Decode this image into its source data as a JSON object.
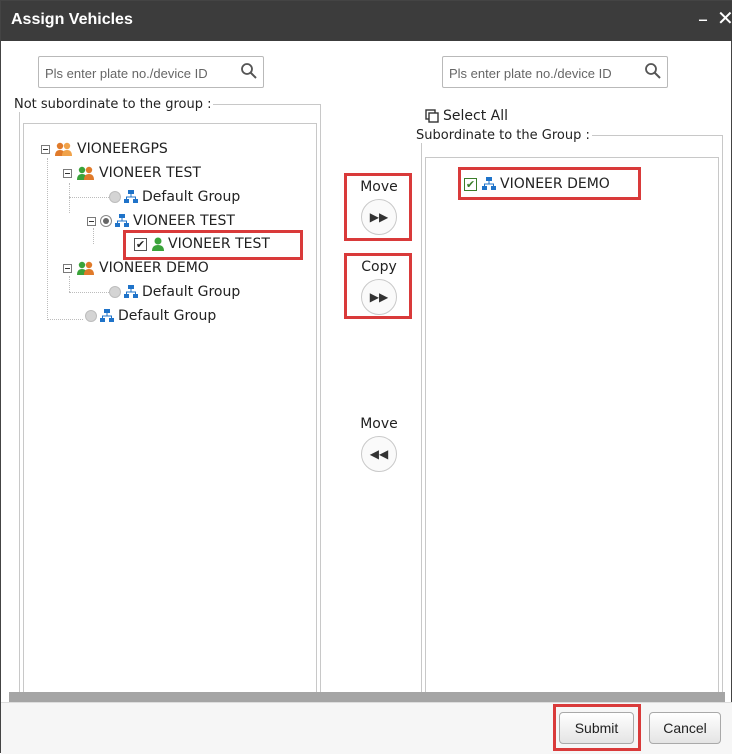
{
  "window": {
    "title": "Assign Vehicles",
    "minimize": "–",
    "close": "✕"
  },
  "left": {
    "search_placeholder": "Pls enter plate no./device ID",
    "group_label": "Not subordinate to the group :",
    "tree": [
      {
        "label": "VIONEERGPS",
        "icon": "users-group-icon"
      },
      {
        "label": "VIONEER TEST",
        "icon": "users-group-icon"
      },
      {
        "label": "Default Group",
        "icon": "org-chart-icon"
      },
      {
        "label": "VIONEER TEST",
        "icon": "org-chart-icon"
      },
      {
        "label": "VIONEER TEST",
        "icon": "user-green-icon",
        "checked": true
      },
      {
        "label": "VIONEER DEMO",
        "icon": "users-group-icon"
      },
      {
        "label": "Default Group",
        "icon": "org-chart-icon"
      },
      {
        "label": "Default Group",
        "icon": "org-chart-icon"
      }
    ]
  },
  "middle": {
    "move_right_label": "Move",
    "copy_label": "Copy",
    "move_left_label": "Move"
  },
  "right": {
    "search_placeholder": "Pls enter plate no./device ID",
    "select_all": "Select All",
    "group_label": "Subordinate to the Group :",
    "items": [
      {
        "label": "VIONEER DEMO",
        "icon": "org-chart-icon",
        "checked": true
      }
    ]
  },
  "footer": {
    "submit": "Submit",
    "cancel": "Cancel"
  },
  "colors": {
    "titlebar": "#3c3c3c",
    "highlight": "#d93a3a",
    "icon_blue": "#1f73c9",
    "icon_orange": "#e07a2a",
    "icon_green": "#3aa33a"
  }
}
